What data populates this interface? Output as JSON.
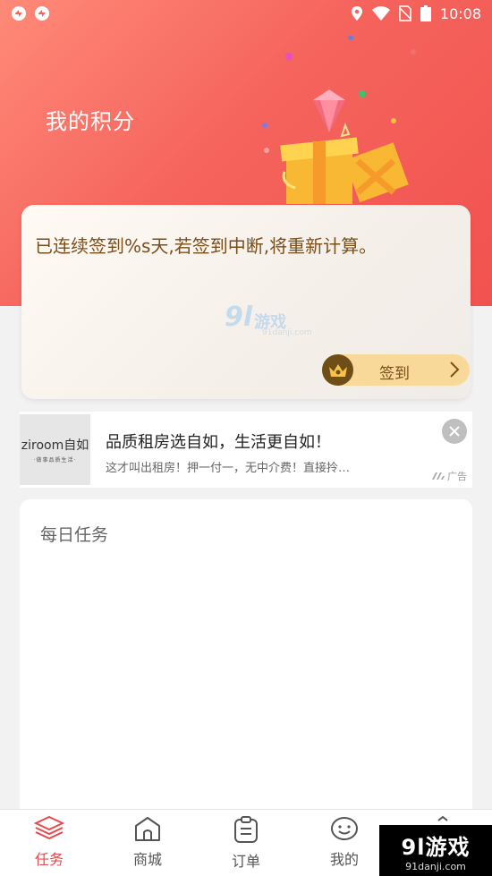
{
  "status_bar": {
    "time": "10:08"
  },
  "header": {
    "title": "我的积分"
  },
  "sign_card": {
    "message": "已连续签到%s天,若签到中断,将重新计算。",
    "button_label": "签到",
    "watermark": {
      "main": "9l",
      "cn": "游戏",
      "sub": "91danji.com"
    }
  },
  "ad": {
    "logo": "ziroom自如",
    "logo_sub": "·做事品质生活·",
    "title": "品质租房选自如，生活更自如！",
    "description": "这才叫出租房！押一付一，无中介费！直接拎…",
    "tag": "广告"
  },
  "tasks": {
    "title": "每日任务"
  },
  "nav": {
    "items": [
      {
        "label": "任务",
        "icon": "layers-icon"
      },
      {
        "label": "商城",
        "icon": "shop-icon"
      },
      {
        "label": "订单",
        "icon": "order-icon"
      },
      {
        "label": "我的",
        "icon": "profile-icon"
      },
      {
        "label": "",
        "icon": "more-icon"
      }
    ]
  },
  "corner_logo": {
    "main": "9l游戏",
    "sub": "91danji.com"
  },
  "colors": {
    "accent": "#e8484b",
    "header_gradient_start": "#ff8a78",
    "header_gradient_end": "#f2524f",
    "sign_button": "#f8d99a",
    "sign_text": "#7a4e1b"
  }
}
